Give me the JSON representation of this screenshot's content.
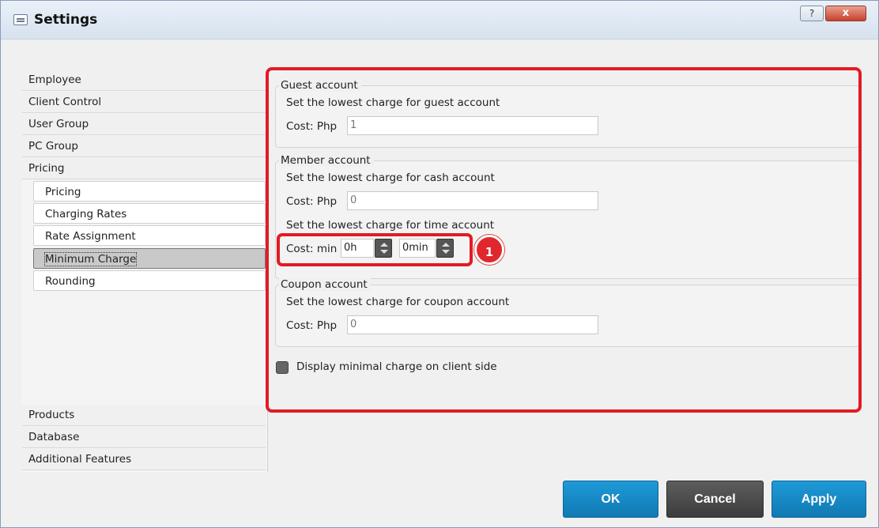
{
  "window": {
    "title": "Settings",
    "help_glyph": "?",
    "close_glyph": "x"
  },
  "nav": {
    "items": [
      {
        "label": "Employee"
      },
      {
        "label": "Client Control"
      },
      {
        "label": "User Group"
      },
      {
        "label": "PC Group"
      },
      {
        "label": "Pricing"
      }
    ],
    "pricing_sub": [
      {
        "label": "Pricing"
      },
      {
        "label": "Charging Rates"
      },
      {
        "label": "Rate Assignment"
      },
      {
        "label": "Minimum Charge",
        "selected": true
      },
      {
        "label": "Rounding"
      }
    ],
    "bottom_items": [
      {
        "label": "Products"
      },
      {
        "label": "Database"
      },
      {
        "label": "Additional Features"
      }
    ]
  },
  "guest": {
    "legend": "Guest account",
    "desc": "Set the lowest charge for guest account",
    "cost_label": "Cost:  Php",
    "value": "1"
  },
  "member": {
    "legend": "Member account",
    "cash_desc": "Set the lowest charge for cash account",
    "cash_cost_label": "Cost:  Php",
    "cash_value": "0",
    "time_desc": "Set the lowest charge for time account",
    "time_cost_label": "Cost: min",
    "hours_value": "0h",
    "minutes_value": "0min"
  },
  "coupon": {
    "legend": "Coupon account",
    "desc": "Set the lowest charge for coupon account",
    "cost_label": "Cost:  Php",
    "value": "0"
  },
  "display_checkbox": {
    "label": "Display minimal charge on client side",
    "checked": false
  },
  "annotation": {
    "badge": "1",
    "color": "#e21b23"
  },
  "buttons": {
    "ok": "OK",
    "cancel": "Cancel",
    "apply": "Apply"
  }
}
